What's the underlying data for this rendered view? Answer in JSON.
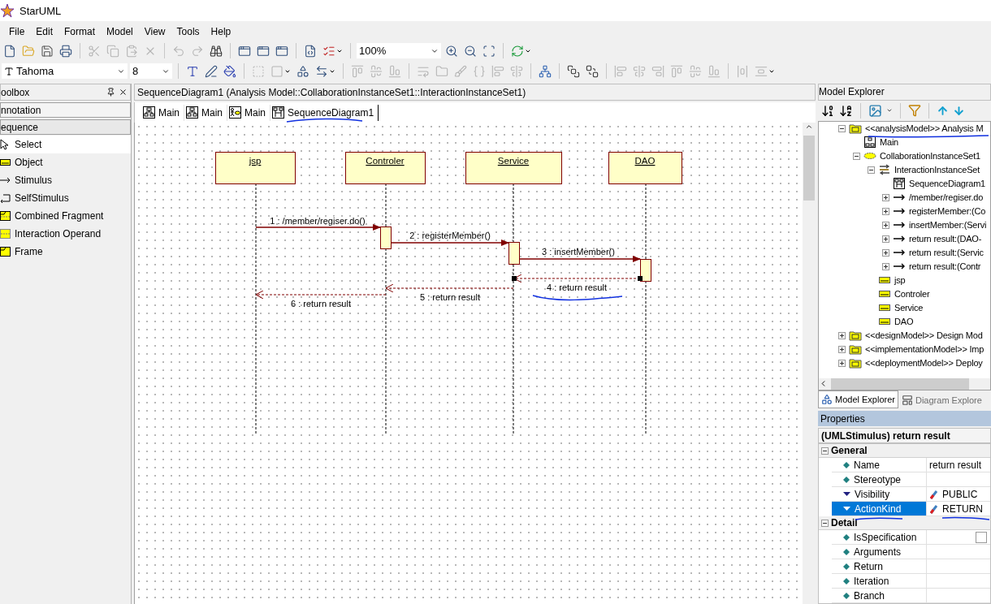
{
  "window": {
    "title": "StarUML"
  },
  "menu": [
    {
      "label": "File"
    },
    {
      "label": "Edit"
    },
    {
      "label": "Format"
    },
    {
      "label": "Model"
    },
    {
      "label": "View"
    },
    {
      "label": "Tools"
    },
    {
      "label": "Help"
    }
  ],
  "toolbar_1": [
    {
      "kind": "new",
      "disabled": false
    },
    {
      "kind": "open",
      "disabled": false
    },
    {
      "kind": "save",
      "disabled": false
    },
    {
      "kind": "print",
      "disabled": false
    },
    {
      "kind": "separator"
    },
    {
      "kind": "cut",
      "disabled": true
    },
    {
      "kind": "copy",
      "disabled": true
    },
    {
      "kind": "paste",
      "disabled": true
    },
    {
      "kind": "delete",
      "disabled": true
    },
    {
      "kind": "separator"
    },
    {
      "kind": "undo",
      "disabled": true
    },
    {
      "kind": "redo",
      "disabled": true
    },
    {
      "kind": "find",
      "disabled": false
    },
    {
      "kind": "separator"
    },
    {
      "kind": "window",
      "disabled": false
    },
    {
      "kind": "window",
      "disabled": false
    },
    {
      "kind": "window",
      "disabled": false
    },
    {
      "kind": "separator"
    },
    {
      "kind": "document",
      "disabled": false
    },
    {
      "kind": "check",
      "disabled": false,
      "dropdown": true
    },
    {
      "kind": "separator"
    },
    {
      "kind": "zoom_combo",
      "value": "100%"
    },
    {
      "kind": "zoom_in",
      "disabled": false
    },
    {
      "kind": "zoom_out",
      "disabled": false
    },
    {
      "kind": "fit",
      "disabled": false
    },
    {
      "kind": "separator"
    },
    {
      "kind": "refresh",
      "disabled": false,
      "dropdown": true
    }
  ],
  "toolbar_2": [
    {
      "kind": "font_combo",
      "value": "Tahoma"
    },
    {
      "kind": "size_combo",
      "value": "8"
    },
    {
      "kind": "separator"
    },
    {
      "kind": "font_color",
      "disabled": false
    },
    {
      "kind": "pen",
      "disabled": false
    },
    {
      "kind": "fill",
      "disabled": false
    },
    {
      "kind": "separator"
    },
    {
      "kind": "frame",
      "disabled": true
    },
    {
      "kind": "stereotype",
      "disabled": true,
      "dropdown": true
    },
    {
      "kind": "shapes",
      "disabled": false
    },
    {
      "kind": "line_style",
      "disabled": false,
      "dropdown": true
    },
    {
      "kind": "separator"
    },
    {
      "kind": "align_top",
      "disabled": true
    },
    {
      "kind": "align_middle",
      "disabled": true
    },
    {
      "kind": "align_bottom",
      "disabled": true
    },
    {
      "kind": "separator"
    },
    {
      "kind": "wrap",
      "disabled": true
    },
    {
      "kind": "folder",
      "disabled": true
    },
    {
      "kind": "brush",
      "disabled": true
    },
    {
      "kind": "braces",
      "disabled": true
    },
    {
      "kind": "align_left",
      "disabled": true
    },
    {
      "kind": "align_center",
      "disabled": true
    },
    {
      "kind": "separator"
    },
    {
      "kind": "tree",
      "disabled": false
    },
    {
      "kind": "separator"
    },
    {
      "kind": "front",
      "disabled": false
    },
    {
      "kind": "back",
      "disabled": false
    },
    {
      "kind": "separator"
    },
    {
      "kind": "align_left",
      "disabled": true
    },
    {
      "kind": "align_center",
      "disabled": true
    },
    {
      "kind": "align_right",
      "disabled": true
    },
    {
      "kind": "align_top",
      "disabled": true
    },
    {
      "kind": "align_middle",
      "disabled": true
    },
    {
      "kind": "align_bottom",
      "disabled": true
    },
    {
      "kind": "separator"
    },
    {
      "kind": "space_h",
      "disabled": true
    },
    {
      "kind": "space_v",
      "disabled": true,
      "dropdown": true
    }
  ],
  "toolbox": {
    "title": "oolbox",
    "sections": [
      {
        "label": "nnotation",
        "expanded": false
      },
      {
        "label": "equence",
        "expanded": true
      }
    ],
    "items": [
      {
        "label": "Select",
        "kind": "select",
        "selected": true
      },
      {
        "label": "Object",
        "kind": "object",
        "selected": false
      },
      {
        "label": "Stimulus",
        "kind": "stimulus",
        "selected": false
      },
      {
        "label": "SelfStimulus",
        "kind": "self",
        "selected": false
      },
      {
        "label": "Combined Fragment",
        "kind": "fragment",
        "selected": false
      },
      {
        "label": "Interaction Operand",
        "kind": "operand",
        "selected": false
      },
      {
        "label": "Frame",
        "kind": "frame",
        "selected": false
      }
    ]
  },
  "editor": {
    "title": "SequenceDiagram1 (Analysis Model::CollaborationInstanceSet1::InteractionInstanceSet1)",
    "tabs": [
      {
        "label": "Main",
        "kind": "class",
        "selected": false
      },
      {
        "label": "Main",
        "kind": "class",
        "selected": false
      },
      {
        "label": "Main",
        "kind": "usecase",
        "selected": false
      },
      {
        "label": "SequenceDiagram1",
        "kind": "sequence",
        "selected": true
      }
    ],
    "objects": [
      {
        "name": "jsp"
      },
      {
        "name": "Controler"
      },
      {
        "name": "Service"
      },
      {
        "name": "DAO"
      }
    ],
    "messages": [
      {
        "label": "1 : /member/regiser.do()",
        "kind": "call"
      },
      {
        "label": "2 : registerMember()",
        "kind": "call"
      },
      {
        "label": "3 : insertMember()",
        "kind": "call"
      },
      {
        "label": "4 : return result",
        "kind": "return",
        "selected": true
      },
      {
        "label": "5 : return result",
        "kind": "return",
        "selected": false
      },
      {
        "label": "6 : return result",
        "kind": "return",
        "selected": false
      }
    ]
  },
  "model_explorer": {
    "title": "Model Explorer",
    "tree": [
      {
        "label": "<<analysisModel>> Analysis M",
        "kind": "model",
        "expanded": true,
        "children": [
          {
            "label": "Main",
            "kind": "diagram"
          },
          {
            "label": "CollaborationInstanceSet1",
            "kind": "collaboration",
            "expanded": true,
            "children": [
              {
                "label": "InteractionInstanceSet",
                "kind": "interaction",
                "expanded": true,
                "children": [
                  {
                    "label": "SequenceDiagram1",
                    "kind": "sequence"
                  },
                  {
                    "label": "/member/regiser.do",
                    "kind": "stimulus",
                    "expanded": false
                  },
                  {
                    "label": "registerMember:(Co",
                    "kind": "stimulus",
                    "expanded": false
                  },
                  {
                    "label": "insertMember:(Servi",
                    "kind": "stimulus",
                    "expanded": false
                  },
                  {
                    "label": "return result:(DAO-",
                    "kind": "stimulus",
                    "expanded": false
                  },
                  {
                    "label": "return result:(Servic",
                    "kind": "stimulus",
                    "expanded": false
                  },
                  {
                    "label": "return result:(Contr",
                    "kind": "stimulus",
                    "expanded": false
                  }
                ]
              },
              {
                "label": "jsp",
                "kind": "object"
              },
              {
                "label": "Controler",
                "kind": "object"
              },
              {
                "label": "Service",
                "kind": "object"
              },
              {
                "label": "DAO",
                "kind": "object"
              }
            ]
          }
        ]
      },
      {
        "label": "<<designModel>> Design Mod",
        "kind": "model",
        "expanded": false
      },
      {
        "label": "<<implementationModel>> Imp",
        "kind": "model",
        "expanded": false
      },
      {
        "label": "<<deploymentModel>> Deploy",
        "kind": "model",
        "expanded": false
      }
    ],
    "tabs": [
      {
        "label": "Model Explorer",
        "selected": true
      },
      {
        "label": "Diagram Explore",
        "selected": false
      }
    ]
  },
  "properties": {
    "title": "Properties",
    "subject": "(UMLStimulus) return result",
    "groups": [
      {
        "label": "General",
        "expanded": true,
        "rows": [
          {
            "name": "Name",
            "kind": "text",
            "value": "return result",
            "selected": false
          },
          {
            "name": "Stereotype",
            "kind": "text",
            "selected": false
          },
          {
            "name": "Visibility",
            "kind": "enum",
            "value": "PUBLIC",
            "selected": false
          },
          {
            "name": "ActionKind",
            "kind": "enum",
            "value": "RETURN",
            "selected": true
          }
        ]
      },
      {
        "label": "Detail",
        "expanded": true,
        "rows": [
          {
            "name": "IsSpecification",
            "kind": "checkbox",
            "checked": false,
            "selected": false
          },
          {
            "name": "Arguments",
            "kind": "text",
            "selected": false
          },
          {
            "name": "Return",
            "kind": "text",
            "selected": false
          },
          {
            "name": "Iteration",
            "kind": "text",
            "selected": false
          },
          {
            "name": "Branch",
            "kind": "text",
            "selected": false
          }
        ]
      }
    ]
  }
}
